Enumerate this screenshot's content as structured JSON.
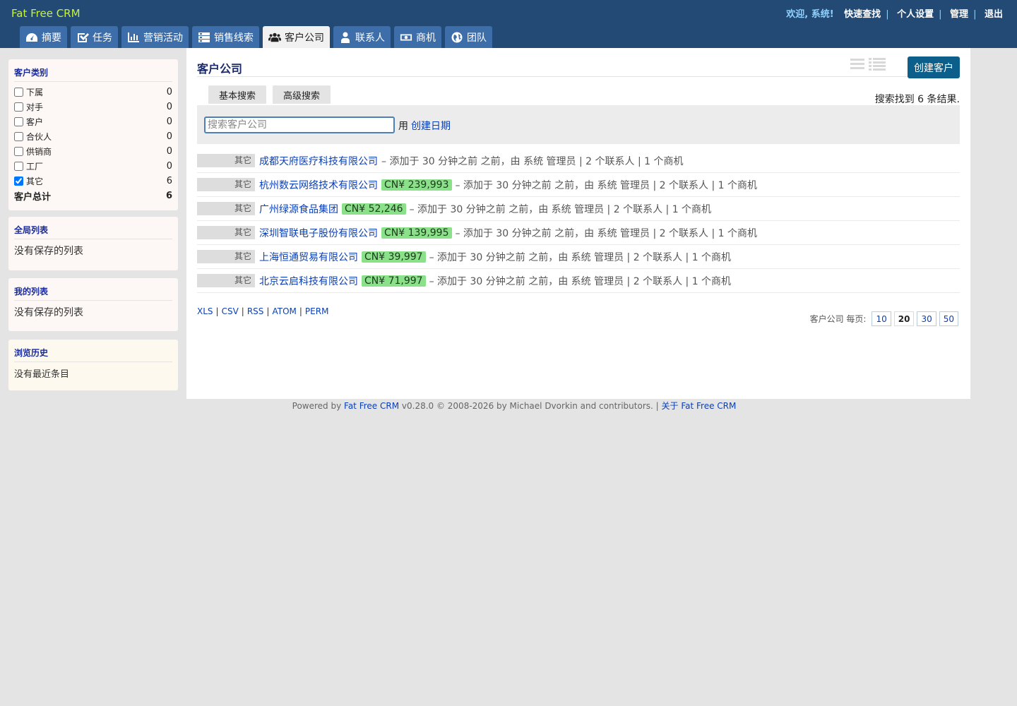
{
  "app": {
    "title": "Fat Free CRM"
  },
  "top_nav": {
    "greeting": "欢迎, 系统!",
    "links": [
      "快速查找",
      "个人设置",
      "管理",
      "退出"
    ]
  },
  "tabs": [
    {
      "label": "摘要",
      "icon": "dashboard-icon",
      "active": false
    },
    {
      "label": "任务",
      "icon": "checkbox-icon",
      "active": false
    },
    {
      "label": "营销活动",
      "icon": "bar-chart-icon",
      "active": false
    },
    {
      "label": "销售线索",
      "icon": "list-icon",
      "active": false
    },
    {
      "label": "客户公司",
      "icon": "users-icon",
      "active": true
    },
    {
      "label": "联系人",
      "icon": "user-icon",
      "active": false
    },
    {
      "label": "商机",
      "icon": "money-icon",
      "active": false
    },
    {
      "label": "团队",
      "icon": "globe-icon",
      "active": false
    }
  ],
  "sidebar": {
    "categories": {
      "title": "客户类别",
      "items": [
        {
          "label": "下属",
          "count": "0",
          "checked": false
        },
        {
          "label": "对手",
          "count": "0",
          "checked": false
        },
        {
          "label": "客户",
          "count": "0",
          "checked": false
        },
        {
          "label": "合伙人",
          "count": "0",
          "checked": false
        },
        {
          "label": "供销商",
          "count": "0",
          "checked": false
        },
        {
          "label": "工厂",
          "count": "0",
          "checked": false
        },
        {
          "label": "其它",
          "count": "6",
          "checked": true
        }
      ],
      "total_label": "客户总计",
      "total_count": "6"
    },
    "global_lists": {
      "title": "全局列表",
      "empty": "没有保存的列表"
    },
    "my_lists": {
      "title": "我的列表",
      "empty": "没有保存的列表"
    },
    "history": {
      "title": "浏览历史",
      "empty": "没有最近条目"
    }
  },
  "main": {
    "title": "客户公司",
    "create_button": "创建客户",
    "search_tabs": [
      "基本搜索",
      "高级搜索"
    ],
    "result_count": "搜索找到 6 条结果.",
    "search": {
      "placeholder": "搜索客户公司",
      "by_label": "用",
      "by_link": "创建日期"
    },
    "accounts": [
      {
        "category": "其它",
        "name": "成都天府医疗科技有限公司",
        "amount": "",
        "desc": "– 添加于 30 分钟之前 之前，由 系统 管理员 | 2 个联系人 | 1 个商机"
      },
      {
        "category": "其它",
        "name": "杭州数云网络技术有限公司",
        "amount": "CN¥ 239,993",
        "desc": "– 添加于 30 分钟之前 之前，由 系统 管理员 | 2 个联系人 | 1 个商机"
      },
      {
        "category": "其它",
        "name": "广州绿源食品集团",
        "amount": "CN¥ 52,246",
        "desc": "– 添加于 30 分钟之前 之前，由 系统 管理员 | 2 个联系人 | 1 个商机"
      },
      {
        "category": "其它",
        "name": "深圳智联电子股份有限公司",
        "amount": "CN¥ 139,995",
        "desc": "– 添加于 30 分钟之前 之前，由 系统 管理员 | 2 个联系人 | 1 个商机"
      },
      {
        "category": "其它",
        "name": "上海恒通贸易有限公司",
        "amount": "CN¥ 39,997",
        "desc": "– 添加于 30 分钟之前 之前，由 系统 管理员 | 2 个联系人 | 1 个商机"
      },
      {
        "category": "其它",
        "name": "北京云启科技有限公司",
        "amount": "CN¥ 71,997",
        "desc": "– 添加于 30 分钟之前 之前，由 系统 管理员 | 2 个联系人 | 1 个商机"
      }
    ],
    "exports": [
      "XLS",
      "CSV",
      "RSS",
      "ATOM",
      "PERM"
    ],
    "per_page": {
      "label": "客户公司 每页:",
      "options": [
        "10",
        "20",
        "30",
        "50"
      ],
      "selected": "20"
    }
  },
  "footer": {
    "prefix": "Powered by",
    "link": "Fat Free CRM",
    "text": "v0.28.0 © 2008-2026 by Michael Dvorkin and contributors. |",
    "about": "关于 Fat Free CRM"
  },
  "colors": {
    "header": "#234a74",
    "tab": "#3d6ea9",
    "brand": "#c8f043",
    "money": "#8be08a",
    "create": "#0b5f8a"
  }
}
